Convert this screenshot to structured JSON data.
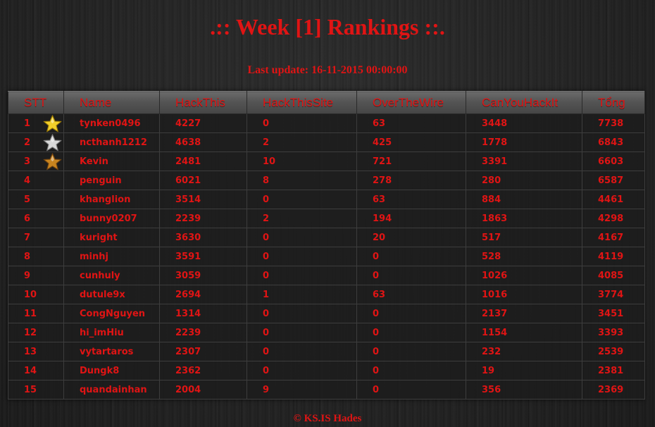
{
  "title": ".:: Week [1] Rankings ::.",
  "last_update": "Last update: 16-11-2015 00:00:00",
  "table": {
    "headers": [
      "STT",
      "Name",
      "HackThis",
      "HackThisSite",
      "OverTheWire",
      "CanYouHackIt",
      "Tổng"
    ],
    "rows": [
      {
        "stt": "1",
        "name": "tynken0496",
        "hackthis": "4227",
        "hackthissite": "0",
        "overthewire": "63",
        "canyouhackit": "3448",
        "total": "7738",
        "medal": "gold-star-icon"
      },
      {
        "stt": "2",
        "name": "ncthanh1212",
        "hackthis": "4638",
        "hackthissite": "2",
        "overthewire": "425",
        "canyouhackit": "1778",
        "total": "6843",
        "medal": "silver-star-icon"
      },
      {
        "stt": "3",
        "name": "Kevin",
        "hackthis": "2481",
        "hackthissite": "10",
        "overthewire": "721",
        "canyouhackit": "3391",
        "total": "6603",
        "medal": "bronze-star-icon"
      },
      {
        "stt": "4",
        "name": "penguin",
        "hackthis": "6021",
        "hackthissite": "8",
        "overthewire": "278",
        "canyouhackit": "280",
        "total": "6587"
      },
      {
        "stt": "5",
        "name": "khanglion",
        "hackthis": "3514",
        "hackthissite": "0",
        "overthewire": "63",
        "canyouhackit": "884",
        "total": "4461"
      },
      {
        "stt": "6",
        "name": "bunny0207",
        "hackthis": "2239",
        "hackthissite": "2",
        "overthewire": "194",
        "canyouhackit": "1863",
        "total": "4298"
      },
      {
        "stt": "7",
        "name": "kuright",
        "hackthis": "3630",
        "hackthissite": "0",
        "overthewire": "20",
        "canyouhackit": "517",
        "total": "4167"
      },
      {
        "stt": "8",
        "name": "minhj",
        "hackthis": "3591",
        "hackthissite": "0",
        "overthewire": "0",
        "canyouhackit": "528",
        "total": "4119"
      },
      {
        "stt": "9",
        "name": "cunhuly",
        "hackthis": "3059",
        "hackthissite": "0",
        "overthewire": "0",
        "canyouhackit": "1026",
        "total": "4085"
      },
      {
        "stt": "10",
        "name": "dutule9x",
        "hackthis": "2694",
        "hackthissite": "1",
        "overthewire": "63",
        "canyouhackit": "1016",
        "total": "3774"
      },
      {
        "stt": "11",
        "name": "CongNguyen",
        "hackthis": "1314",
        "hackthissite": "0",
        "overthewire": "0",
        "canyouhackit": "2137",
        "total": "3451"
      },
      {
        "stt": "12",
        "name": "hi_imHiu",
        "hackthis": "2239",
        "hackthissite": "0",
        "overthewire": "0",
        "canyouhackit": "1154",
        "total": "3393"
      },
      {
        "stt": "13",
        "name": "vytartaros",
        "hackthis": "2307",
        "hackthissite": "0",
        "overthewire": "0",
        "canyouhackit": "232",
        "total": "2539"
      },
      {
        "stt": "14",
        "name": "Dungk8",
        "hackthis": "2362",
        "hackthissite": "0",
        "overthewire": "0",
        "canyouhackit": "19",
        "total": "2381"
      },
      {
        "stt": "15",
        "name": "quandainhan",
        "hackthis": "2004",
        "hackthissite": "9",
        "overthewire": "0",
        "canyouhackit": "356",
        "total": "2369"
      }
    ]
  },
  "footer": "© KS.IS Hades",
  "colors": {
    "accent_red": "#e01414",
    "gold": "#f2cf2a",
    "silver": "#d8d8d8",
    "bronze": "#c8841f"
  }
}
